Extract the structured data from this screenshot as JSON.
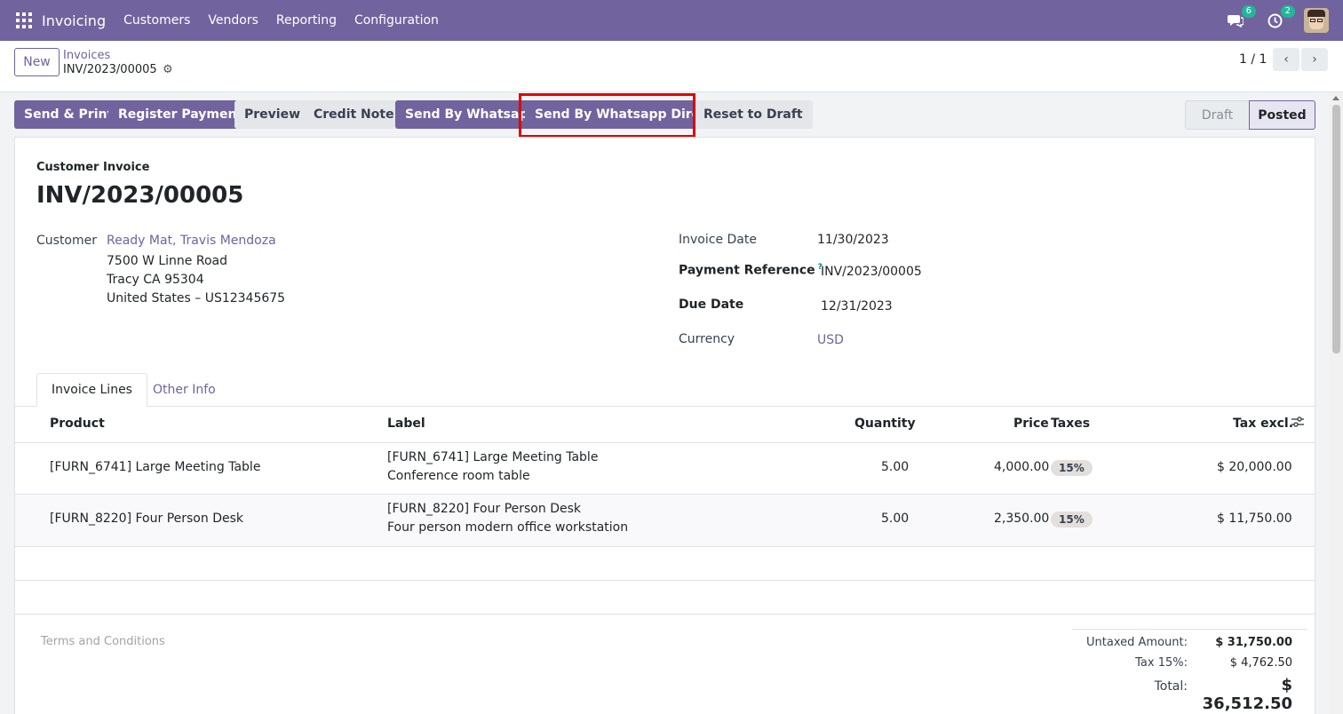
{
  "navbar": {
    "app_name": "Invoicing",
    "menu": [
      "Customers",
      "Vendors",
      "Reporting",
      "Configuration"
    ],
    "messages_badge": "6",
    "activities_badge": "2"
  },
  "control": {
    "new_label": "New",
    "breadcrumb_parent": "Invoices",
    "breadcrumb_current": "INV/2023/00005",
    "pager": "1 / 1"
  },
  "actions": {
    "send_print": "Send & Print",
    "register_payment": "Register Payment",
    "preview": "Preview",
    "credit_note": "Credit Note",
    "send_whatsapp": "Send By Whatsapp",
    "send_whatsapp_direct": "Send By Whatsapp Direct",
    "reset_draft": "Reset to Draft"
  },
  "status": {
    "draft": "Draft",
    "posted": "Posted"
  },
  "invoice": {
    "type": "Customer Invoice",
    "number": "INV/2023/00005",
    "customer_label": "Customer",
    "customer_name": "Ready Mat, Travis Mendoza",
    "address_line1": "7500 W Linne Road",
    "address_line2": "Tracy CA 95304",
    "address_line3": "United States – US12345675",
    "invoice_date_label": "Invoice Date",
    "invoice_date": "11/30/2023",
    "payment_ref_label": "Payment Reference",
    "payment_ref_help": "?",
    "payment_ref": "INV/2023/00005",
    "due_date_label": "Due Date",
    "due_date": "12/31/2023",
    "currency_label": "Currency",
    "currency": "USD"
  },
  "tabs": {
    "invoice_lines": "Invoice Lines",
    "other_info": "Other Info"
  },
  "table": {
    "headers": {
      "product": "Product",
      "label": "Label",
      "quantity": "Quantity",
      "price": "Price",
      "taxes": "Taxes",
      "tax_excl": "Tax excl."
    },
    "rows": [
      {
        "product": "[FURN_6741] Large Meeting Table",
        "label1": "[FURN_6741] Large Meeting Table",
        "label2": "Conference room table",
        "quantity": "5.00",
        "price": "4,000.00",
        "tax": "15%",
        "subtotal": "$ 20,000.00"
      },
      {
        "product": "[FURN_8220] Four Person Desk",
        "label1": "[FURN_8220] Four Person Desk",
        "label2": "Four person modern office workstation",
        "quantity": "5.00",
        "price": "2,350.00",
        "tax": "15%",
        "subtotal": "$ 11,750.00"
      }
    ]
  },
  "footer": {
    "terms_placeholder": "Terms and Conditions",
    "untaxed_label": "Untaxed Amount:",
    "untaxed_value": "$ 31,750.00",
    "tax_label": "Tax 15%:",
    "tax_value": "$ 4,762.50",
    "total_label": "Total:",
    "total_value": "$ 36,512.50"
  }
}
